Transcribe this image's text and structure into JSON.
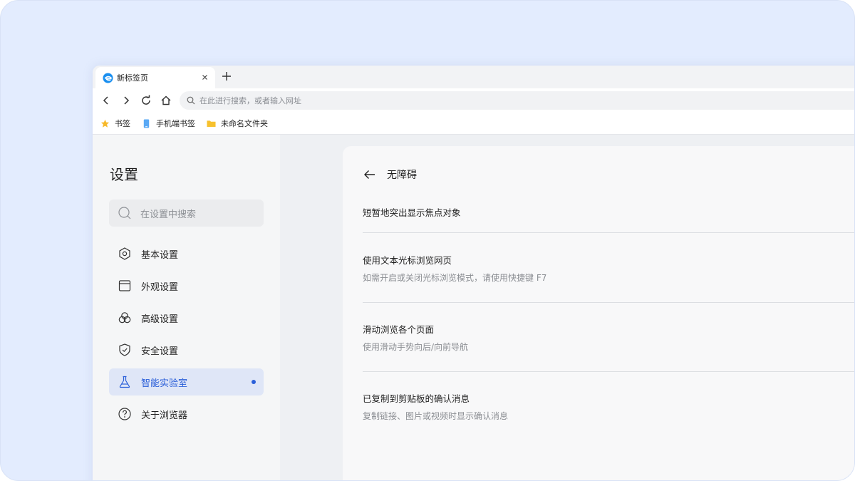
{
  "tab": {
    "title": "新标签页"
  },
  "omnibox": {
    "placeholder": "在此进行搜索，或者输入网址"
  },
  "bookmarks": [
    {
      "label": "书签",
      "icon": "star-icon"
    },
    {
      "label": "手机端书签",
      "icon": "phone-icon"
    },
    {
      "label": "未命名文件夹",
      "icon": "folder-icon"
    }
  ],
  "sidebar": {
    "title": "设置",
    "search_placeholder": "在设置中搜索",
    "items": [
      {
        "label": "基本设置",
        "icon": "hexagon-gear-icon"
      },
      {
        "label": "外观设置",
        "icon": "window-icon"
      },
      {
        "label": "高级设置",
        "icon": "circles-icon"
      },
      {
        "label": "安全设置",
        "icon": "shield-check-icon"
      },
      {
        "label": "智能实验室",
        "icon": "flask-icon",
        "active": true
      },
      {
        "label": "关于浏览器",
        "icon": "question-circle-icon"
      }
    ]
  },
  "panel": {
    "title": "无障碍",
    "rows": [
      {
        "title": "短暂地突出显示焦点对象"
      },
      {
        "title": "使用文本光标浏览网页",
        "subtitle": "如需开启或关闭光标浏览模式，请使用快捷键 F7"
      },
      {
        "title": "滑动浏览各个页面",
        "subtitle": "使用滑动手势向后/向前导航"
      },
      {
        "title": "已复制到剪贴板的确认消息",
        "subtitle": "复制链接、图片或视频时显示确认消息"
      }
    ]
  },
  "colors": {
    "accent": "#2b5fd9",
    "background": "#e3ecfe",
    "active_bg": "#dfe6f7"
  }
}
